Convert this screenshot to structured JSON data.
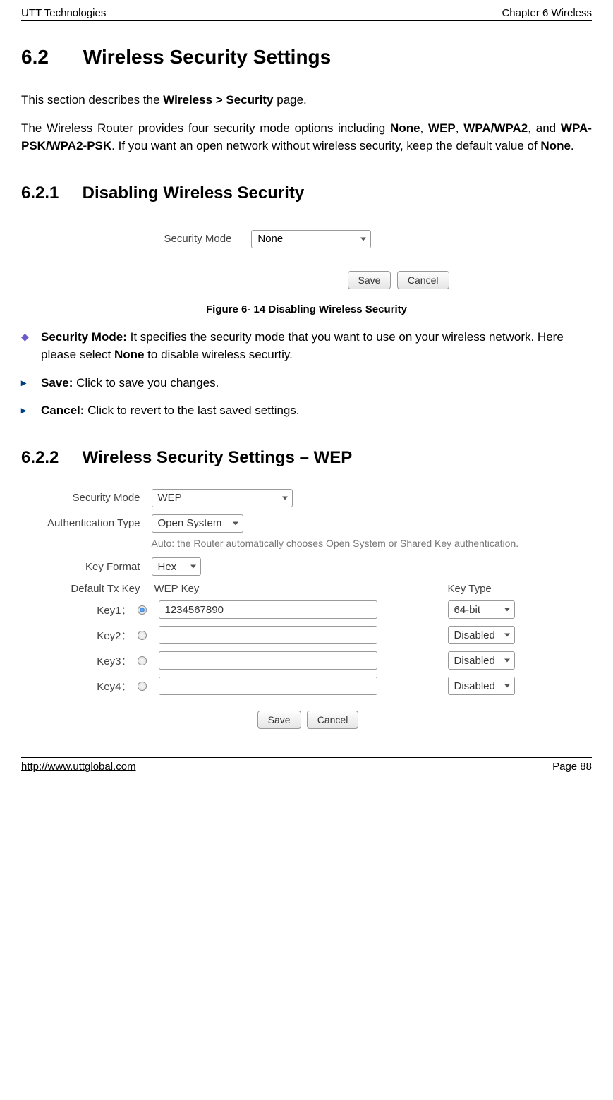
{
  "header": {
    "left": "UTT Technologies",
    "right": "Chapter 6 Wireless"
  },
  "section": {
    "num": "6.2",
    "title": "Wireless Security Settings"
  },
  "intro": {
    "p1_a": "This section describes the ",
    "p1_b": "Wireless > Security",
    "p1_c": " page.",
    "p2_a": "The Wireless Router provides four security mode options including ",
    "p2_b": "None",
    "p2_c": ", ",
    "p2_d": "WEP",
    "p2_e": ", ",
    "p2_f": "WPA/WPA2",
    "p2_g": ", and ",
    "p2_h": "WPA-PSK/WPA2-PSK",
    "p2_i": ". If you want an open network without wireless security, keep the default value of ",
    "p2_j": "None",
    "p2_k": "."
  },
  "sub1": {
    "num": "6.2.1",
    "title": "Disabling Wireless Security"
  },
  "figure1": {
    "security_mode_label": "Security Mode",
    "security_mode_value": "None",
    "save": "Save",
    "cancel": "Cancel",
    "caption": "Figure 6- 14 Disabling Wireless Security"
  },
  "bullets1": {
    "b1_head": "Security Mode: ",
    "b1_tail_a": "It specifies the security mode that you want to use on your wireless network. Here please select ",
    "b1_tail_b": "None",
    "b1_tail_c": " to disable wireless securtiy.",
    "b2_head": "Save: ",
    "b2_tail": "Click to save you changes.",
    "b3_head": "Cancel: ",
    "b3_tail": "Click to revert to the last saved settings."
  },
  "sub2": {
    "num": "6.2.2",
    "title": "Wireless Security Settings – WEP"
  },
  "figure2": {
    "security_mode_label": "Security Mode",
    "security_mode_value": "WEP",
    "auth_type_label": "Authentication Type",
    "auth_type_value": "Open System",
    "auth_hint": "Auto: the Router automatically chooses Open System or Shared Key authentication.",
    "key_format_label": "Key Format",
    "key_format_value": "Hex",
    "default_tx_key_label": "Default Tx Key",
    "wep_key_header": "WEP Key",
    "key_type_header": "Key Type",
    "keys": [
      {
        "label": "Key1：",
        "value": "1234567890",
        "type": "64-bit",
        "checked": true
      },
      {
        "label": "Key2：",
        "value": "",
        "type": "Disabled",
        "checked": false
      },
      {
        "label": "Key3：",
        "value": "",
        "type": "Disabled",
        "checked": false
      },
      {
        "label": "Key4：",
        "value": "",
        "type": "Disabled",
        "checked": false
      }
    ],
    "save": "Save",
    "cancel": "Cancel"
  },
  "footer": {
    "link": "http://www.uttglobal.com",
    "page": "Page 88"
  }
}
